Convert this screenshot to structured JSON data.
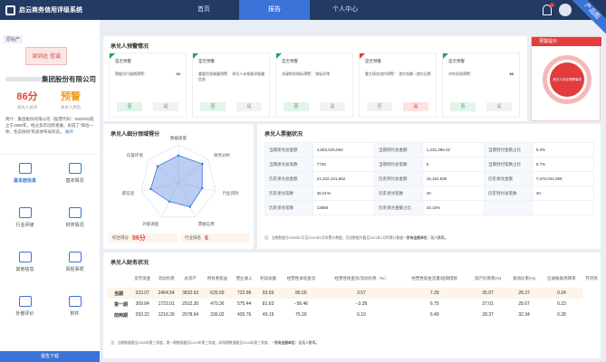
{
  "brand": {
    "logo_text": "启云商务信用评级系统"
  },
  "nav": [
    {
      "label": "首页"
    },
    {
      "label": "报告"
    },
    {
      "label": "个人中心"
    }
  ],
  "ribbon": "产品图",
  "company": {
    "tag": "原始产",
    "logo_text": "深圳达 信诚",
    "name": "集团股份有限公司",
    "score": "86分",
    "score_label": "承兑人总评",
    "risk": "预警",
    "risk_label": "承兑人风险",
    "desc": "简介：集团股份有限公司（股票代码：000000)成立于1990年，经过多年创新发展，形成了\"四位一体、生态协同\"的总体布局形态。",
    "desc_more": "展开"
  },
  "sidebar": [
    {
      "label": "基本面信息"
    },
    {
      "label": "基本情况"
    },
    {
      "label": "行业评级"
    },
    {
      "label": "财务情况"
    },
    {
      "label": "其他信息"
    },
    {
      "label": "风险事项"
    },
    {
      "label": "外部评价"
    },
    {
      "label": "附件"
    }
  ],
  "report_button": "报告下载",
  "warning": {
    "title": "承兑人预警情况",
    "cards": [
      {
        "title": "是否预警",
        "label": "票据兑付逾期预警：",
        "value": "63",
        "yes": "否",
        "no": "是"
      },
      {
        "title": "是否预警",
        "label": "重要信息披露预警：\n承兑人未按要求披露信息",
        "value": "",
        "yes": "否",
        "no": "是"
      },
      {
        "title": "是否预警",
        "label": "关键财务指标预警：\n指标异常",
        "value": "",
        "yes": "否",
        "no": "是"
      },
      {
        "title": "是否预警",
        "label": "重大债务违约预警：\n违约金额 / 违约日期",
        "value": "",
        "yes": "否",
        "no": "是"
      },
      {
        "title": "是否预警",
        "label": "对外担保预警：",
        "value": "86",
        "yes": "否",
        "no": "是"
      }
    ]
  },
  "alert": {
    "title": "预警提示",
    "text": "承兑人存在预警事项"
  },
  "radar": {
    "title": "承兑人细分领域得分",
    "axes": [
      "数据质量",
      "财务分析",
      "行业风险",
      "票据信用",
      "外部调查",
      "职信息",
      "信誉环境"
    ],
    "values": [
      0.72,
      0.8,
      0.64,
      0.7,
      0.55,
      0.75,
      0.7
    ],
    "total_label": "综合得分",
    "total_value": "86分",
    "rank_label": "行业排名",
    "rank_value": "6"
  },
  "bill": {
    "title": "承兑人票据状况",
    "rows": [
      [
        "当期承兑总金额",
        "4,563,626,593",
        "当期到付总金额",
        "1,232,396.02",
        "当期到付金额占比",
        "0.3%"
      ],
      [
        "当期承兑总笔数",
        "7725",
        "当期到付总笔数",
        "5",
        "当期到付笔数占比",
        "0.7%"
      ],
      [
        "历史承兑总金额",
        "21,322,151,662",
        "历史到付总金额",
        "16,154,935",
        "历史承兑金额",
        "7,676,043,359"
      ],
      [
        "历史承兑笔数",
        "36.01%",
        "历史承兑笔数",
        "40",
        "历史到付总笔数",
        "40"
      ],
      [
        "历史承兑笔数",
        "13880",
        "历史承兑金额占比",
        "33.15%",
        "",
        ""
      ]
    ],
    "note": "注：当期数据为2020年1月至2021年1月的累计数据；历史数据为截至2021年1月的累计数据",
    "note_bold": "* 所有金额单位：元人民币。"
  },
  "finance": {
    "title": "承兑人财务状况",
    "headers": [
      "",
      "货币资金",
      "流动负债",
      "总资产",
      "所有者权益",
      "营业收入",
      "利润总额",
      "经营性净现金流",
      "经营性现金流/流动负债（%）",
      "经营性现金流量/短期借款",
      "资产负债率(%)",
      "速动比率(%)",
      "应收账款周转率",
      "存货周"
    ],
    "rows": [
      [
        "当期",
        "323.07",
        "2464.54",
        "3832.63",
        "625.69",
        "722.96",
        "93.69",
        "86.05",
        "3.57",
        "7.29",
        "35.07",
        "28.37",
        "0.24"
      ],
      [
        "第一期",
        "309.84",
        "1722.01",
        "2912.30",
        "470.36",
        "575.44",
        "81.63",
        "−56.46",
        "−3.39",
        "6.75",
        "37.01",
        "28.67",
        "0.23"
      ],
      [
        "前两期",
        "293.22",
        "1216.39",
        "2078.64",
        "336.02",
        "435.76",
        "49.19",
        "75.26",
        "6.19",
        "6.49",
        "28.37",
        "32.34",
        "0.28"
      ]
    ],
    "note": "注：当期数据截至2020年第三季度，第一期数据截至2019年第三季度，前两期数据截至2018年第三季度。",
    "note_bold": "* 所有金额单位：亿元人民币。"
  },
  "colors": {
    "accent": "#3b73d9",
    "header": "#233a63",
    "alert": "#e23c3c",
    "ok": "#21a35a"
  }
}
